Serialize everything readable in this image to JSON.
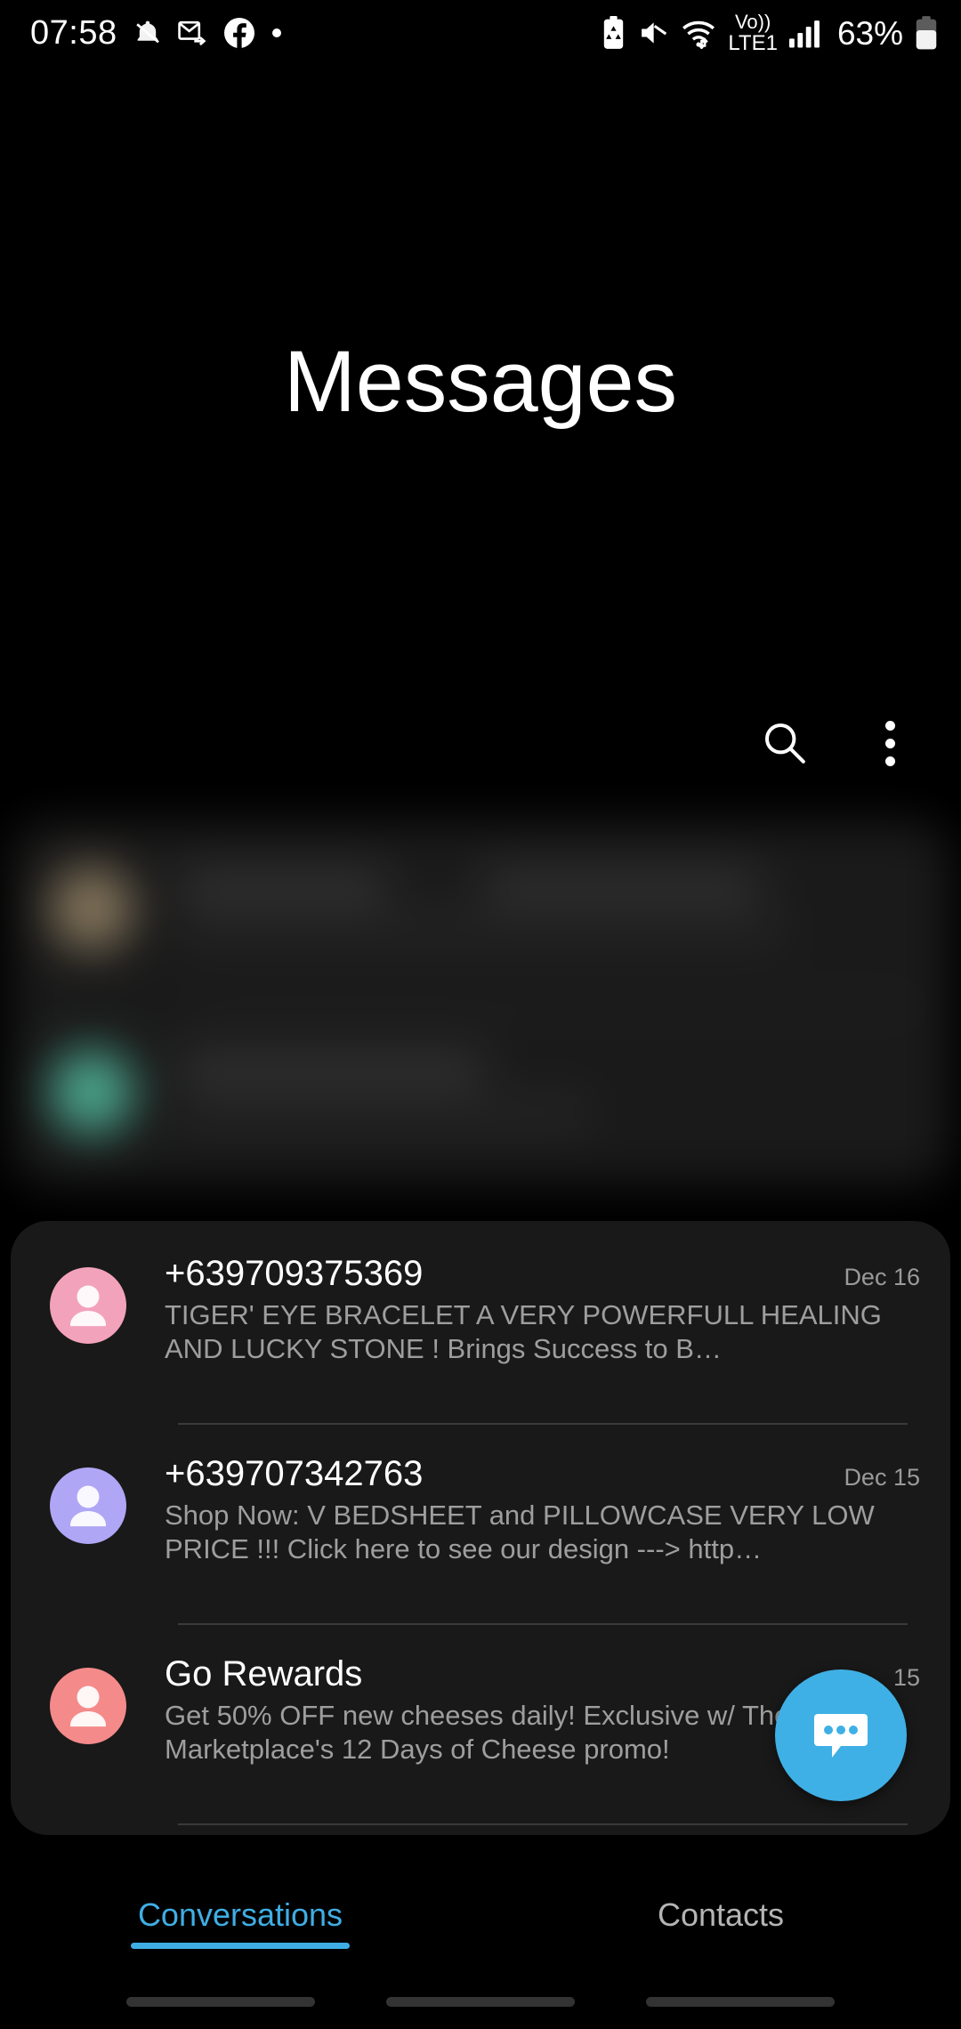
{
  "status_bar": {
    "time": "07:58",
    "left_icons": [
      "alarm-mute-icon",
      "email-forward-icon",
      "facebook-icon",
      "dot-icon"
    ],
    "right_icons": [
      "battery-saver-icon",
      "sound-mute-icon",
      "wifi-icon",
      "volte-icon",
      "signal-bars-icon"
    ],
    "volte_label": "Vo))",
    "network_label": "LTE1",
    "battery_percent": "63%"
  },
  "header": {
    "title": "Messages",
    "search_label": "search-icon",
    "menu_label": "more-options-icon"
  },
  "blurred_preview": {
    "rows": [
      {
        "avatar_color": "#8a7a60"
      },
      {
        "avatar_color": "#4fae94"
      }
    ]
  },
  "conversations": [
    {
      "name": "+639709375369",
      "date": "Dec 16",
      "preview": "TIGER' EYE BRACELET  A VERY POWERFULL HEALING AND LUCKY STONE !  Brings Success to B…",
      "avatar_color": "#F3A2BC"
    },
    {
      "name": "+639707342763",
      "date": "Dec 15",
      "preview": "Shop Now: V BEDSHEET and PILLOWCASE  VERY LOW PRICE !!!  Click here to see our design ---> http…",
      "avatar_color": "#AFA6F5"
    },
    {
      "name": "Go Rewards",
      "date": "15",
      "preview": "Get 50% OFF new cheeses daily! Exclusive w/ The Marketplace's 12 Days of Cheese promo!",
      "avatar_color": "#F58A8A"
    }
  ],
  "fab": {
    "icon": "new-message-icon"
  },
  "tabs": [
    {
      "label": "Conversations",
      "active": true
    },
    {
      "label": "Contacts",
      "active": false
    }
  ],
  "gesture_nav": {
    "pills": [
      "recents-pill",
      "home-pill",
      "back-pill"
    ]
  },
  "colors": {
    "accent": "#3FAEE4",
    "fab": "#3FB0E5",
    "card_bg": "#191919",
    "page_bg": "#000000",
    "secondary_text": "#9e9e9e"
  }
}
